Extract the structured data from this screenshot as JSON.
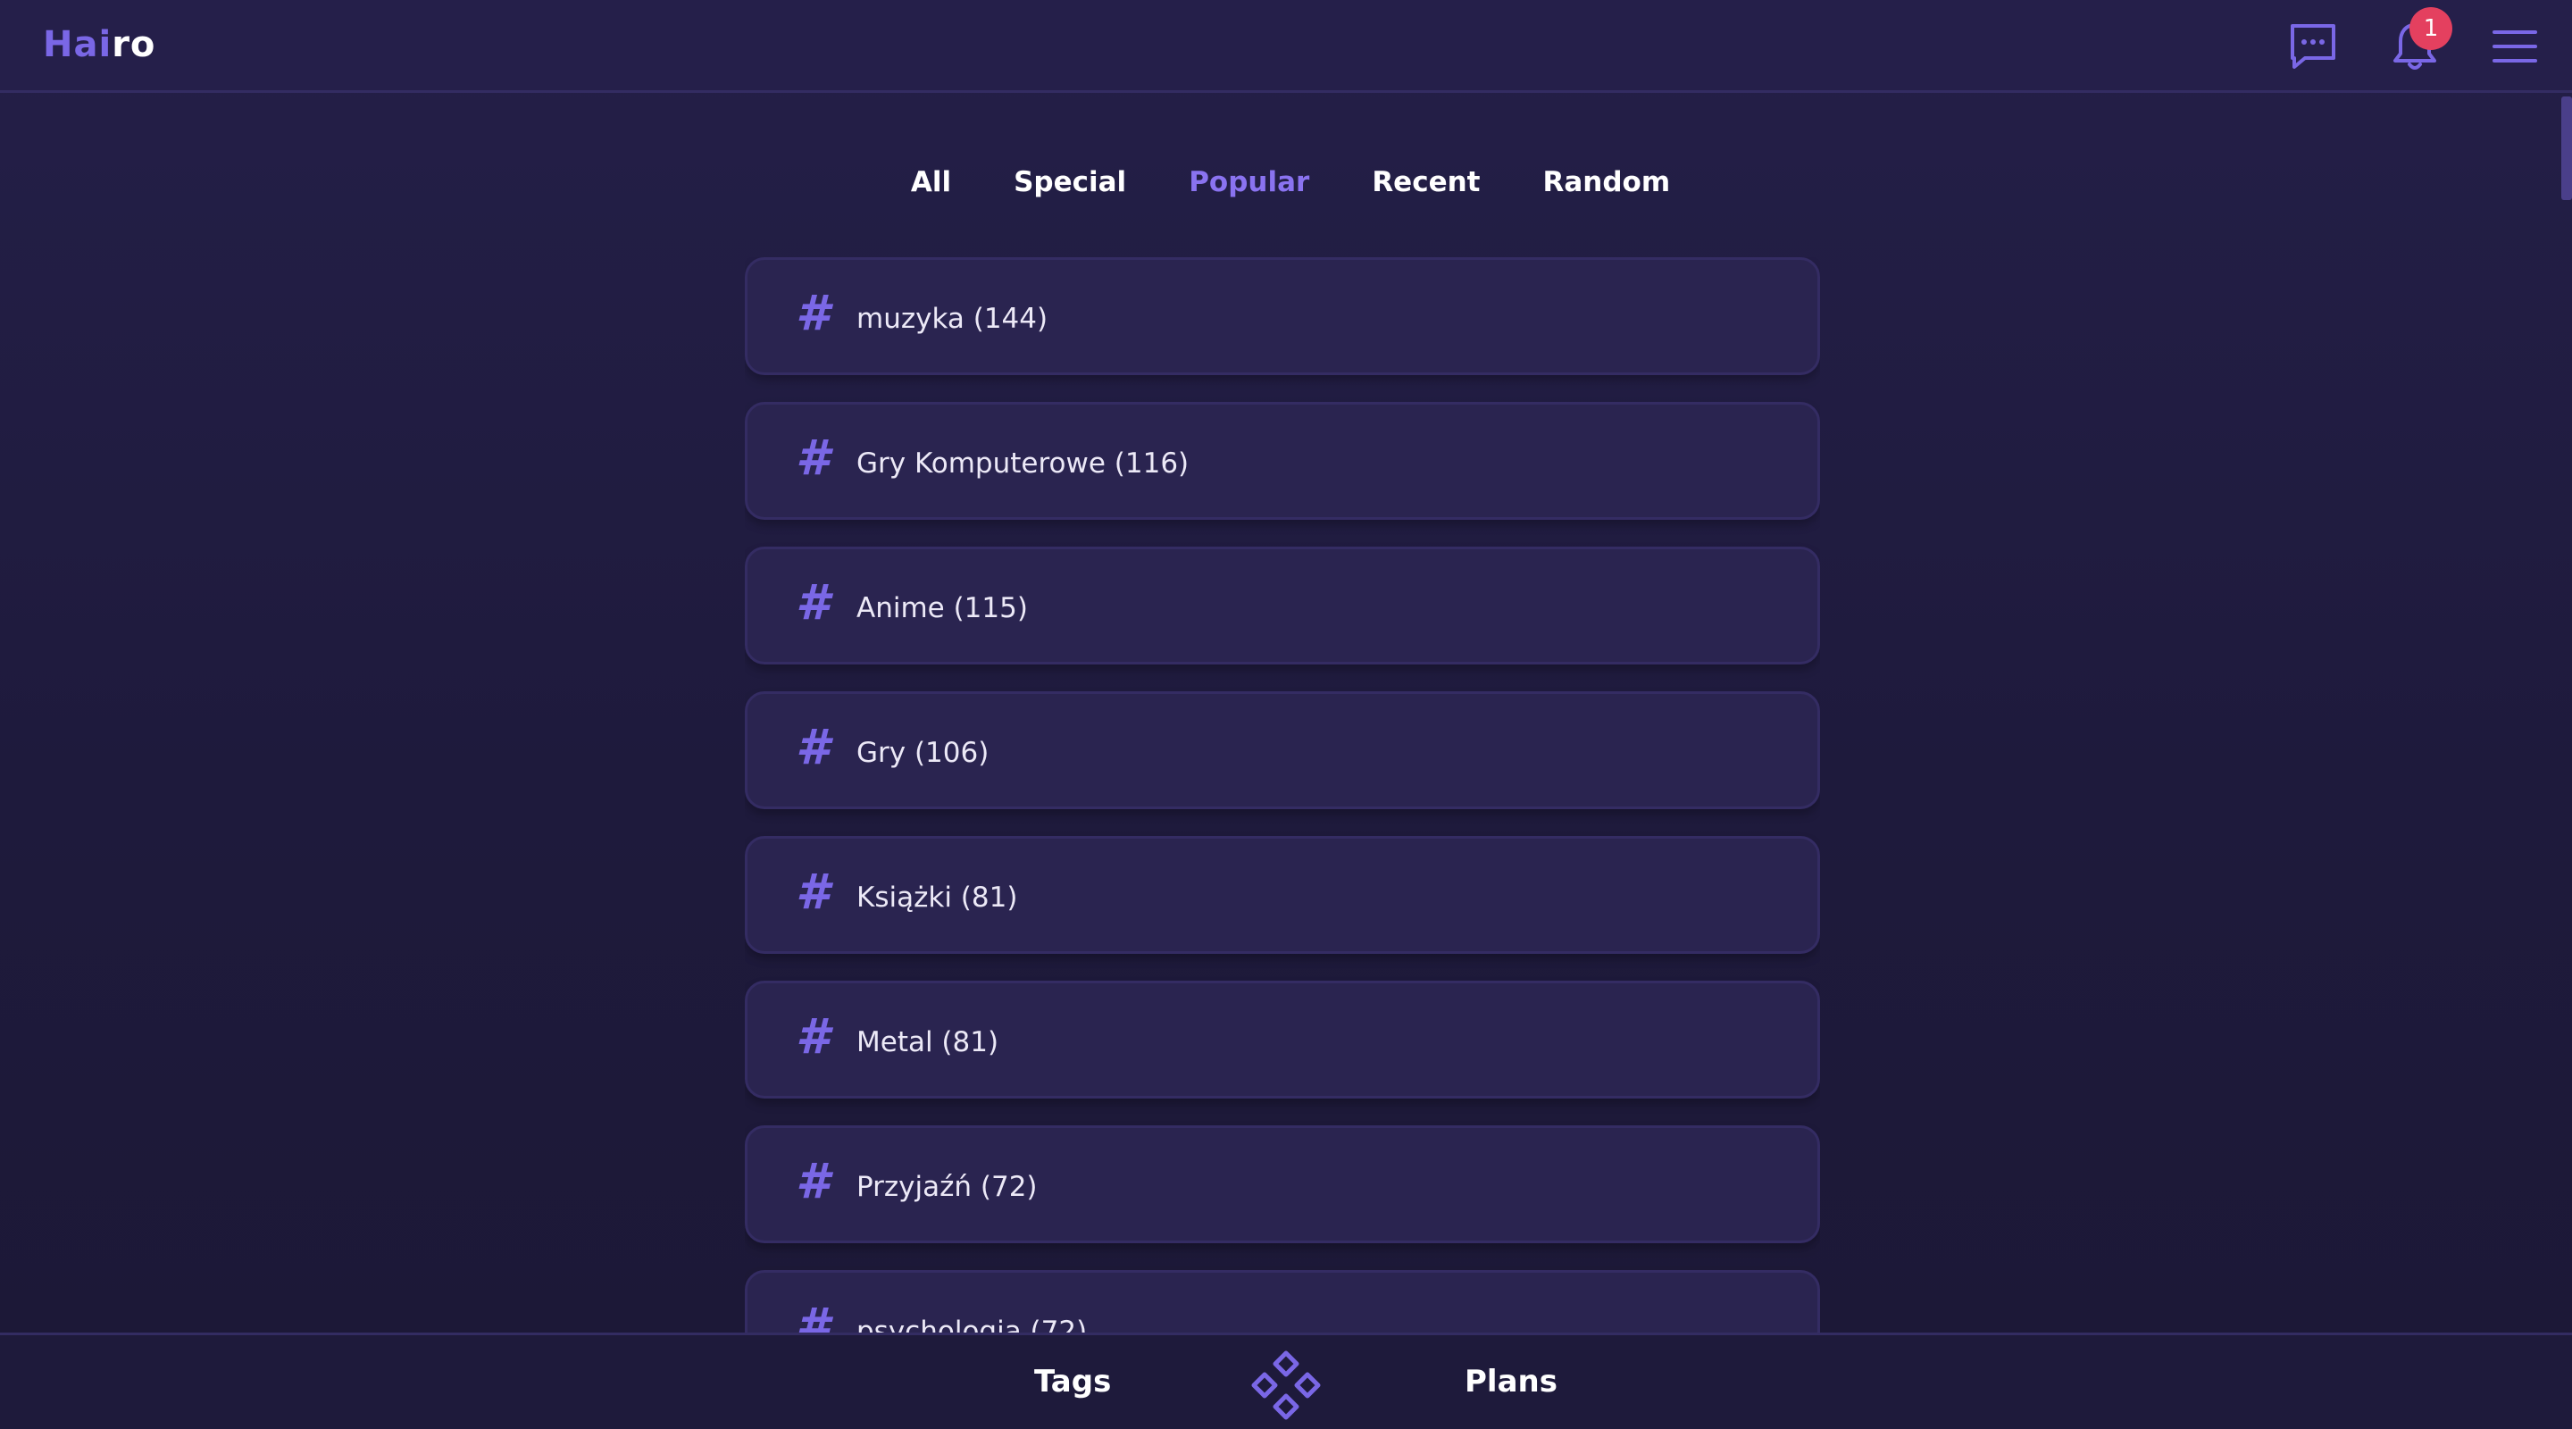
{
  "app": {
    "logo_accent": "Hai",
    "logo_rest": "ro"
  },
  "header": {
    "notification_count": "1",
    "icons": [
      "chat-icon",
      "bell-icon",
      "menu-icon"
    ]
  },
  "tabs": [
    {
      "label": "All",
      "active": false
    },
    {
      "label": "Special",
      "active": false
    },
    {
      "label": "Popular",
      "active": true
    },
    {
      "label": "Recent",
      "active": false
    },
    {
      "label": "Random",
      "active": false
    }
  ],
  "tags": [
    {
      "hash": "#",
      "label": "muzyka (144)"
    },
    {
      "hash": "#",
      "label": "Gry Komputerowe (116)"
    },
    {
      "hash": "#",
      "label": "Anime (115)"
    },
    {
      "hash": "#",
      "label": "Gry (106)"
    },
    {
      "hash": "#",
      "label": "Książki (81)"
    },
    {
      "hash": "#",
      "label": "Metal (81)"
    },
    {
      "hash": "#",
      "label": "Przyjaźń (72)"
    },
    {
      "hash": "#",
      "label": "psychologia (72)"
    }
  ],
  "bottom_nav": {
    "tags_label": "Tags",
    "plans_label": "Plans",
    "center_icon": "diamond-logo-icon"
  },
  "colors": {
    "accent": "#7a67e6",
    "active_tab": "#8a73f0",
    "badge": "#e4405f",
    "background": "#221d44",
    "card": "#2a2450"
  }
}
